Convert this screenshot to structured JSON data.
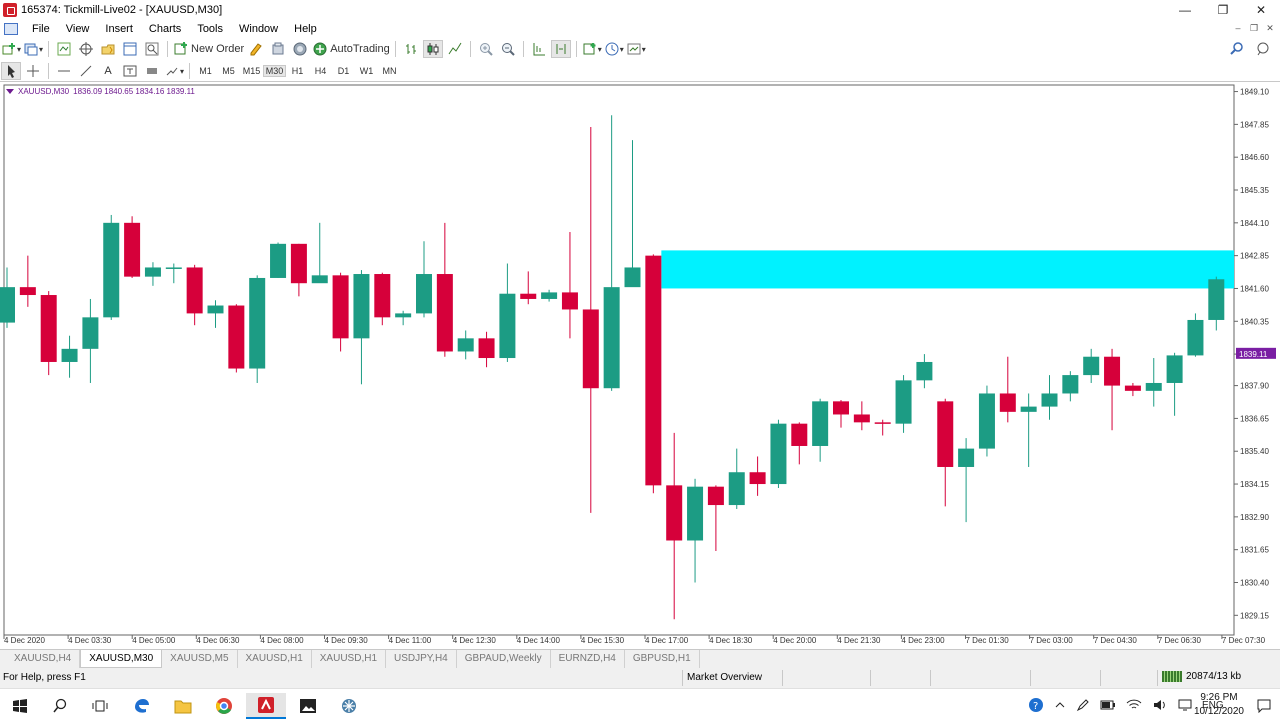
{
  "window": {
    "title": "165374: Tickmill-Live02 - [XAUUSD,M30]",
    "buttons": [
      "—",
      "❐",
      "✕"
    ]
  },
  "menu": {
    "items": [
      "File",
      "View",
      "Insert",
      "Charts",
      "Tools",
      "Window",
      "Help"
    ]
  },
  "toolbar": {
    "new_order": "New Order",
    "auto_trading": "AutoTrading"
  },
  "timeframes": [
    "M1",
    "M5",
    "M15",
    "M30",
    "H1",
    "H4",
    "D1",
    "W1",
    "MN"
  ],
  "active_timeframe": "M30",
  "chart_info": {
    "symbol": "XAUUSD,M30",
    "ohlc": "1836.09 1840.65 1834.16 1839.11"
  },
  "colors": {
    "bull": "#1c9c84",
    "bear": "#d6003a",
    "zone": "#00f2ff",
    "info": "#6d1a8f",
    "price_label_bg": "#7a1ea3"
  },
  "chart_data": {
    "type": "candlestick",
    "symbol": "XAUUSD",
    "timeframe": "M30",
    "ylim": [
      1828.4,
      1849.35
    ],
    "y_ticks": [
      "1849.10",
      "1847.85",
      "1846.60",
      "1845.35",
      "1844.10",
      "1842.85",
      "1841.60",
      "1840.35",
      "1839.10",
      "1837.90",
      "1836.65",
      "1835.40",
      "1834.15",
      "1832.90",
      "1831.65",
      "1830.40",
      "1829.15"
    ],
    "current_price": "1839.11",
    "x_ticks": [
      "4 Dec 2020",
      "4 Dec 03:30",
      "4 Dec 05:00",
      "4 Dec 06:30",
      "4 Dec 08:00",
      "4 Dec 09:30",
      "4 Dec 11:00",
      "4 Dec 12:30",
      "4 Dec 14:00",
      "4 Dec 15:30",
      "4 Dec 17:00",
      "4 Dec 18:30",
      "4 Dec 20:00",
      "4 Dec 21:30",
      "4 Dec 23:00",
      "7 Dec 01:30",
      "7 Dec 03:00",
      "7 Dec 04:30",
      "7 Dec 06:30",
      "7 Dec 07:30"
    ],
    "candles": [
      [
        1840.3,
        1841.65,
        1842.4,
        1840.1
      ],
      [
        1841.65,
        1841.35,
        1842.85,
        1840.9
      ],
      [
        1841.35,
        1838.8,
        1841.5,
        1838.3
      ],
      [
        1838.8,
        1839.3,
        1839.8,
        1838.2
      ],
      [
        1839.3,
        1840.5,
        1841.2,
        1838.0
      ],
      [
        1840.5,
        1844.1,
        1844.4,
        1840.4
      ],
      [
        1844.1,
        1842.05,
        1844.35,
        1842.0
      ],
      [
        1842.05,
        1842.4,
        1842.6,
        1841.7
      ],
      [
        1842.4,
        1842.4,
        1842.55,
        1841.8
      ],
      [
        1842.4,
        1840.65,
        1842.5,
        1840.2
      ],
      [
        1840.65,
        1840.95,
        1841.15,
        1840.1
      ],
      [
        1840.95,
        1838.55,
        1841.0,
        1838.4
      ],
      [
        1838.55,
        1842.0,
        1842.1,
        1838.0
      ],
      [
        1842.0,
        1843.3,
        1843.35,
        1842.0
      ],
      [
        1843.3,
        1841.8,
        1843.3,
        1841.3
      ],
      [
        1841.8,
        1842.1,
        1844.1,
        1841.9
      ],
      [
        1842.1,
        1839.7,
        1842.2,
        1839.2
      ],
      [
        1839.7,
        1842.15,
        1842.3,
        1837.95
      ],
      [
        1842.15,
        1840.5,
        1842.2,
        1840.2
      ],
      [
        1840.5,
        1840.65,
        1840.75,
        1840.2
      ],
      [
        1840.65,
        1842.15,
        1843.4,
        1840.5
      ],
      [
        1842.15,
        1839.2,
        1844.1,
        1839.0
      ],
      [
        1839.2,
        1839.7,
        1840.0,
        1838.9
      ],
      [
        1839.7,
        1838.95,
        1839.95,
        1838.6
      ],
      [
        1838.95,
        1841.4,
        1842.55,
        1838.8
      ],
      [
        1841.4,
        1841.2,
        1842.25,
        1841.0
      ],
      [
        1841.2,
        1841.45,
        1841.55,
        1841.1
      ],
      [
        1841.45,
        1840.8,
        1843.75,
        1839.7
      ],
      [
        1840.8,
        1837.8,
        1847.75,
        1833.05
      ],
      [
        1837.8,
        1841.65,
        1848.2,
        1837.7
      ],
      [
        1841.65,
        1842.4,
        1847.25,
        1842.2
      ],
      [
        1842.85,
        1834.1,
        1842.9,
        1833.8
      ],
      [
        1834.1,
        1832.0,
        1836.1,
        1829.0
      ],
      [
        1832.0,
        1834.05,
        1834.35,
        1830.4
      ],
      [
        1834.05,
        1833.35,
        1834.1,
        1831.6
      ],
      [
        1833.35,
        1834.6,
        1835.5,
        1833.2
      ],
      [
        1834.6,
        1834.15,
        1835.2,
        1833.7
      ],
      [
        1834.15,
        1836.45,
        1836.6,
        1834.0
      ],
      [
        1836.45,
        1835.6,
        1836.5,
        1834.9
      ],
      [
        1835.6,
        1837.3,
        1837.4,
        1835.0
      ],
      [
        1837.3,
        1836.8,
        1837.35,
        1836.3
      ],
      [
        1836.8,
        1836.5,
        1837.3,
        1836.2
      ],
      [
        1836.5,
        1836.45,
        1836.6,
        1836.0
      ],
      [
        1836.45,
        1838.1,
        1838.3,
        1836.1
      ],
      [
        1838.1,
        1838.8,
        1839.1,
        1837.8
      ],
      [
        1837.3,
        1834.8,
        1837.4,
        1833.3
      ],
      [
        1834.8,
        1835.5,
        1835.9,
        1832.7
      ],
      [
        1835.5,
        1837.6,
        1837.9,
        1835.2
      ],
      [
        1837.6,
        1836.9,
        1839.0,
        1836.5
      ],
      [
        1836.9,
        1837.1,
        1837.6,
        1834.8
      ],
      [
        1837.1,
        1837.6,
        1838.3,
        1836.6
      ],
      [
        1837.6,
        1838.3,
        1838.45,
        1837.3
      ],
      [
        1838.3,
        1839.0,
        1839.3,
        1838.0
      ],
      [
        1839.0,
        1837.9,
        1839.3,
        1836.2
      ],
      [
        1837.9,
        1837.7,
        1838.0,
        1837.5
      ],
      [
        1837.7,
        1838.0,
        1838.95,
        1837.1
      ],
      [
        1838.0,
        1839.05,
        1839.15,
        1836.75
      ],
      [
        1839.05,
        1840.4,
        1840.65,
        1839.0
      ],
      [
        1840.4,
        1841.95,
        1842.05,
        1840.0
      ]
    ]
  },
  "tabs": {
    "items": [
      "XAUUSD,H4",
      "XAUUSD,M30",
      "XAUUSD,M5",
      "XAUUSD,H1",
      "XAUUSD,H1",
      "USDJPY,H4",
      "GBPAUD,Weekly",
      "EURNZD,H4",
      "GBPUSD,H1"
    ],
    "active": 1
  },
  "status": {
    "help": "For Help, press F1",
    "market": "Market Overview",
    "traffic": "20874/13 kb"
  },
  "taskbar": {
    "lang": "ENG",
    "time": "9:26 PM",
    "date": "10/12/2020"
  }
}
